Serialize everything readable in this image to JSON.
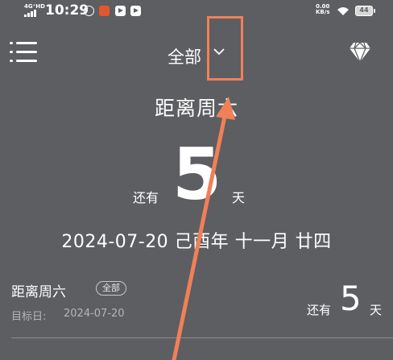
{
  "status_bar": {
    "network": "4G⁺HD",
    "time": "10:29",
    "speed_value": "0.00",
    "speed_unit": "KB/s",
    "battery": "44"
  },
  "header": {
    "filter_label": "全部"
  },
  "countdown": {
    "title": "距离周六",
    "prefix": "还有",
    "days": "5",
    "unit": "天",
    "date_line": "2024-07-20 己酉年 十一月 廿四"
  },
  "list": {
    "items": [
      {
        "title": "距离周六",
        "badge": "全部",
        "date_label": "目标日:",
        "date_value": "2024-07-20",
        "prefix": "还有",
        "days": "5",
        "unit": "天"
      }
    ]
  },
  "colors": {
    "background": "#5d5e62",
    "annotation": "#f08058",
    "text": "#ffffff"
  }
}
